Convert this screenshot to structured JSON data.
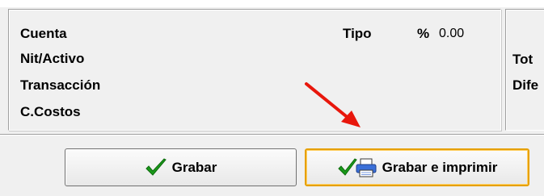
{
  "panel": {
    "labels": {
      "cuenta": "Cuenta",
      "nit_activo": "Nit/Activo",
      "transaccion": "Transacción",
      "ccostos": "C.Costos",
      "tipo": "Tipo",
      "percent": "%"
    },
    "percent_value": "0.00"
  },
  "right_panel": {
    "line1": "Tot",
    "line2": "Dife"
  },
  "buttons": {
    "save": {
      "label": "Grabar",
      "icon": "checkmark-icon"
    },
    "save_print": {
      "label": "Grabar e imprimir",
      "icons": [
        "checkmark-icon",
        "printer-icon"
      ]
    }
  },
  "annotation": {
    "icon": "red-arrow-icon",
    "color": "#e8170c"
  },
  "colors": {
    "check": "#1a9a1a",
    "focus_border": "#e6a000",
    "printer": "#3a6fd8"
  }
}
